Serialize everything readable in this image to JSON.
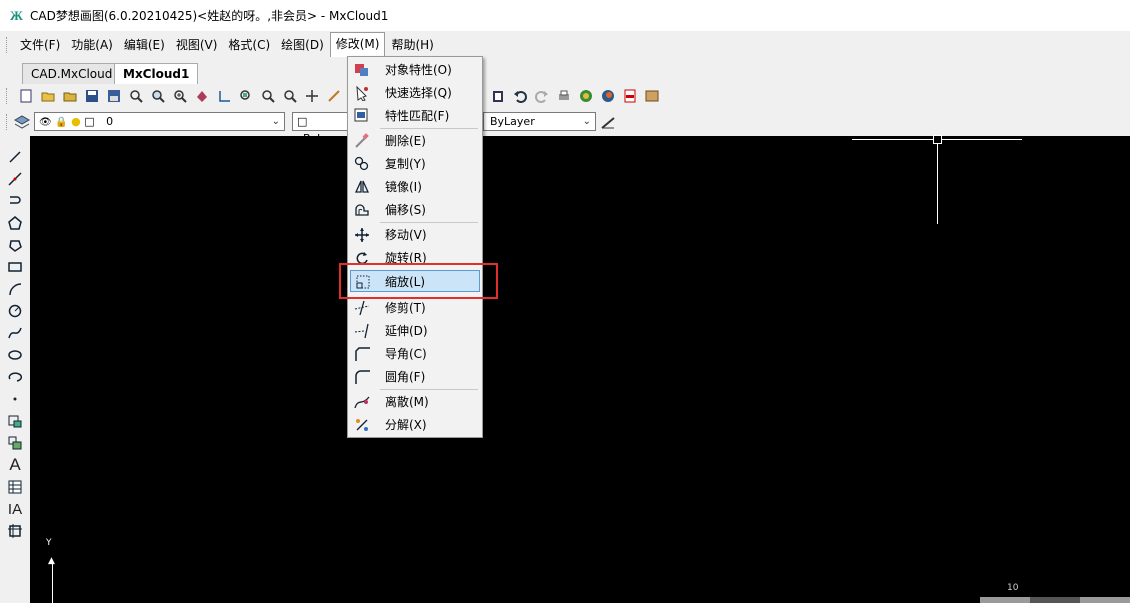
{
  "window": {
    "title": "CAD梦想画图(6.0.20210425)<姓赵的呀。,非会员> - MxCloud1",
    "app_icon": "Ж"
  },
  "menubar": {
    "items": [
      "文件(F)",
      "功能(A)",
      "编辑(E)",
      "视图(V)",
      "格式(C)",
      "绘图(D)",
      "修改(M)",
      "帮助(H)"
    ],
    "open_index": 6
  },
  "tabs": [
    {
      "label": "CAD.MxCloud"
    },
    {
      "label": "MxCloud1"
    }
  ],
  "layer_bar": {
    "layer_value": "0",
    "color_value": "ByLay",
    "linetype_value": "ByLayer"
  },
  "modify_menu": {
    "items": [
      {
        "label": "对象特性(O)",
        "icon": "properties-icon"
      },
      {
        "label": "快速选择(Q)",
        "icon": "quick-select-icon"
      },
      {
        "label": "特性匹配(F)",
        "icon": "match-properties-icon"
      },
      {
        "label": "删除(E)",
        "icon": "erase-icon"
      },
      {
        "label": "复制(Y)",
        "icon": "copy-icon"
      },
      {
        "label": "镜像(I)",
        "icon": "mirror-icon"
      },
      {
        "label": "偏移(S)",
        "icon": "offset-icon"
      },
      {
        "label": "移动(V)",
        "icon": "move-icon"
      },
      {
        "label": "旋转(R)",
        "icon": "rotate-icon"
      },
      {
        "label": "缩放(L)",
        "icon": "scale-icon"
      },
      {
        "label": "修剪(T)",
        "icon": "trim-icon"
      },
      {
        "label": "延伸(D)",
        "icon": "extend-icon"
      },
      {
        "label": "导角(C)",
        "icon": "chamfer-icon"
      },
      {
        "label": "圆角(F)",
        "icon": "fillet-icon"
      },
      {
        "label": "离散(M)",
        "icon": "divide-icon"
      },
      {
        "label": "分解(X)",
        "icon": "explode-icon"
      }
    ],
    "highlighted_index": 9
  },
  "canvas": {
    "ucs_label": "Y",
    "scale_label": "10"
  },
  "colors": {
    "canvas_bg": "#000000",
    "highlight": "#cce4f7",
    "annotation_box": "#e0302c"
  }
}
